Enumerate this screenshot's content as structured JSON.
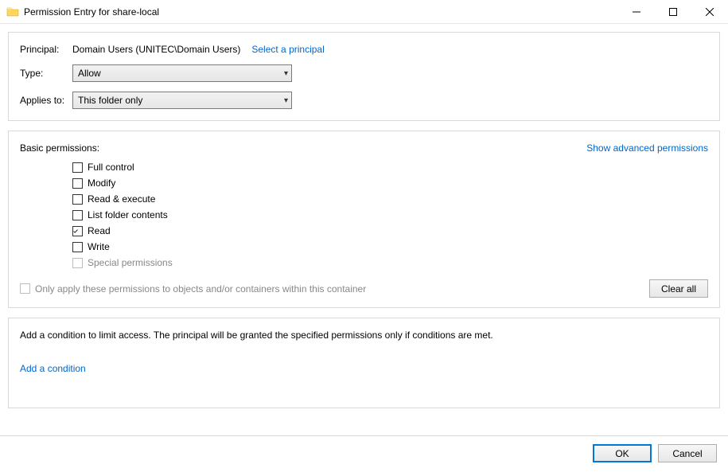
{
  "window": {
    "title": "Permission Entry for share-local"
  },
  "principal": {
    "label": "Principal:",
    "value": "Domain Users (UNITEC\\Domain Users)",
    "select_link": "Select a principal"
  },
  "type": {
    "label": "Type:",
    "value": "Allow"
  },
  "applies_to": {
    "label": "Applies to:",
    "value": "This folder only"
  },
  "permissions": {
    "heading": "Basic permissions:",
    "advanced_link": "Show advanced permissions",
    "items": [
      {
        "label": "Full control",
        "checked": false,
        "disabled": false
      },
      {
        "label": "Modify",
        "checked": false,
        "disabled": false
      },
      {
        "label": "Read & execute",
        "checked": false,
        "disabled": false
      },
      {
        "label": "List folder contents",
        "checked": false,
        "disabled": false
      },
      {
        "label": "Read",
        "checked": true,
        "disabled": false
      },
      {
        "label": "Write",
        "checked": false,
        "disabled": false
      },
      {
        "label": "Special permissions",
        "checked": false,
        "disabled": true
      }
    ],
    "only_apply_label": "Only apply these permissions to objects and/or containers within this container",
    "clear_all": "Clear all"
  },
  "condition": {
    "description": "Add a condition to limit access. The principal will be granted the specified permissions only if conditions are met.",
    "add_link": "Add a condition"
  },
  "footer": {
    "ok": "OK",
    "cancel": "Cancel"
  }
}
